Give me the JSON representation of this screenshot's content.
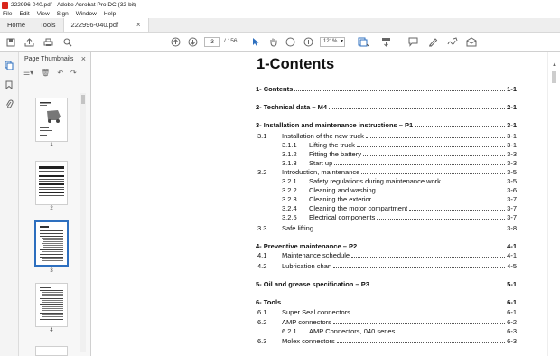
{
  "window": {
    "title": "222996-040.pdf - Adobe Acrobat Pro DC (32-bit)"
  },
  "menu": [
    "File",
    "Edit",
    "View",
    "Sign",
    "Window",
    "Help"
  ],
  "tabs": {
    "home": "Home",
    "tools": "Tools",
    "document": "222996-040.pdf"
  },
  "toolbar": {
    "current_page": "3",
    "page_count": "/ 156",
    "zoom": "121%",
    "icons": [
      "save-icon",
      "upload-icon",
      "print-icon",
      "search-icon",
      "prev-page-icon",
      "next-page-icon",
      "select-tool-icon",
      "hand-tool-icon",
      "zoom-out-icon",
      "zoom-in-icon",
      "page-display-icon",
      "scroll-icon",
      "comment-icon",
      "highlight-icon",
      "sign-icon",
      "share-icon"
    ]
  },
  "thumbnails": {
    "title": "Page Thumbnails",
    "pages": [
      "1",
      "2",
      "3",
      "4"
    ],
    "selected": "3"
  },
  "document": {
    "heading": "1-Contents",
    "toc": [
      {
        "num": "1- Contents",
        "title": "",
        "page": "1-1",
        "level": 0,
        "bold": true
      },
      {
        "num": "2- Technical data – M4",
        "title": "",
        "page": "2-1",
        "level": 0,
        "bold": true
      },
      {
        "num": "3- Installation and maintenance instructions – P1",
        "title": "",
        "page": "3-1",
        "level": 0,
        "bold": true
      },
      {
        "num": "3.1",
        "title": "Installation of the new truck",
        "page": "3-1",
        "level": 1,
        "bold": false
      },
      {
        "num": "3.1.1",
        "title": "Lifting the truck",
        "page": "3-1",
        "level": 2,
        "bold": false
      },
      {
        "num": "3.1.2",
        "title": "Fitting the battery",
        "page": "3-3",
        "level": 2,
        "bold": false
      },
      {
        "num": "3.1.3",
        "title": "Start up",
        "page": "3-3",
        "level": 2,
        "bold": false
      },
      {
        "num": "3.2",
        "title": "Introduction, maintenance",
        "page": "3-5",
        "level": 1,
        "bold": false
      },
      {
        "num": "3.2.1",
        "title": "Safety regulations during maintenance work",
        "page": "3-5",
        "level": 2,
        "bold": false
      },
      {
        "num": "3.2.2",
        "title": "Cleaning and washing",
        "page": "3-6",
        "level": 2,
        "bold": false
      },
      {
        "num": "3.2.3",
        "title": "Cleaning the exterior",
        "page": "3-7",
        "level": 2,
        "bold": false
      },
      {
        "num": "3.2.4",
        "title": "Cleaning the motor compartment",
        "page": "3-7",
        "level": 2,
        "bold": false
      },
      {
        "num": "3.2.5",
        "title": "Electrical components",
        "page": "3-7",
        "level": 2,
        "bold": false
      },
      {
        "num": "3.3",
        "title": "Safe lifting",
        "page": "3-8",
        "level": 1,
        "bold": false
      },
      {
        "num": "4- Preventive maintenance – P2",
        "title": "",
        "page": "4-1",
        "level": 0,
        "bold": true
      },
      {
        "num": "4.1",
        "title": "Maintenance schedule",
        "page": "4-1",
        "level": 1,
        "bold": false
      },
      {
        "num": "4.2",
        "title": "Lubrication chart",
        "page": "4-5",
        "level": 1,
        "bold": false
      },
      {
        "num": "5- Oil and grease specification – P3",
        "title": "",
        "page": "5-1",
        "level": 0,
        "bold": true
      },
      {
        "num": "6- Tools",
        "title": "",
        "page": "6-1",
        "level": 0,
        "bold": true
      },
      {
        "num": "6.1",
        "title": "Super Seal connectors",
        "page": "6-1",
        "level": 1,
        "bold": false
      },
      {
        "num": "6.2",
        "title": "AMP connectors",
        "page": "6-2",
        "level": 1,
        "bold": false
      },
      {
        "num": "6.2.1",
        "title": "AMP Connectors, 040 series",
        "page": "6-3",
        "level": 2,
        "bold": false
      },
      {
        "num": "6.3",
        "title": "Molex connectors",
        "page": "6-3",
        "level": 1,
        "bold": false
      }
    ]
  }
}
